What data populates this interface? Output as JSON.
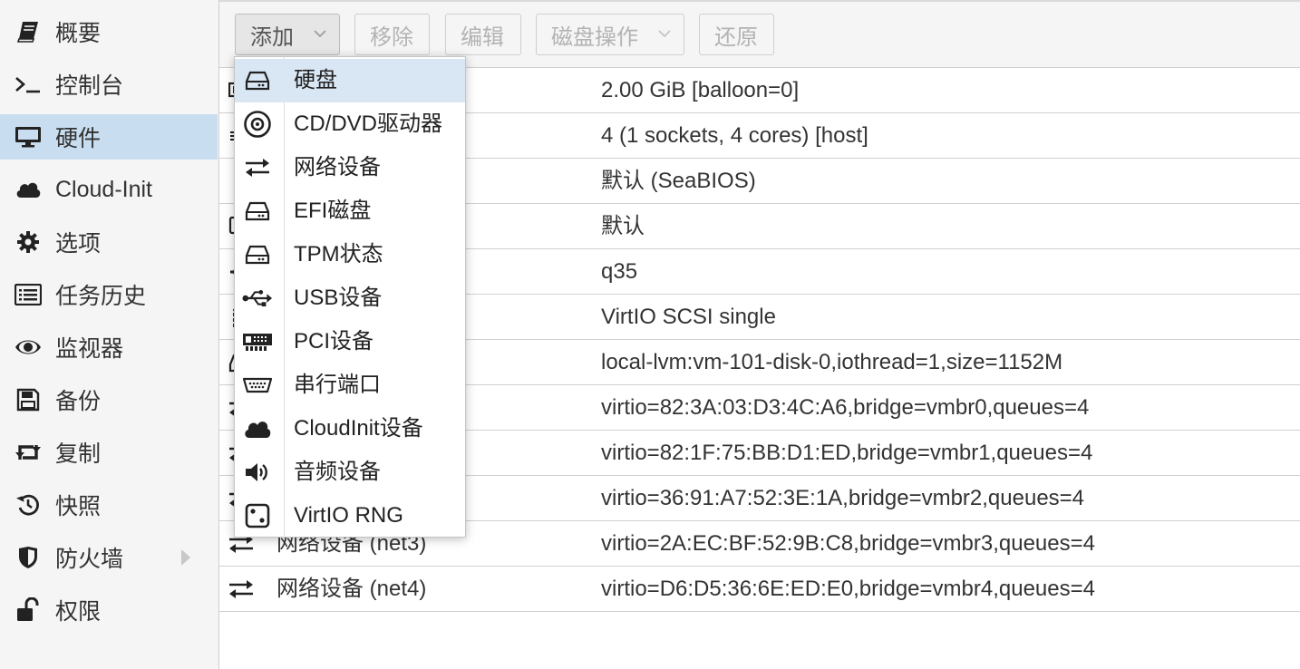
{
  "sidebar": {
    "items": [
      {
        "label": "概要",
        "icon": "book-icon",
        "active": false
      },
      {
        "label": "控制台",
        "icon": "terminal-icon",
        "active": false
      },
      {
        "label": "硬件",
        "icon": "monitor-icon",
        "active": true
      },
      {
        "label": "Cloud-Init",
        "icon": "cloud-icon",
        "active": false
      },
      {
        "label": "选项",
        "icon": "gear-icon",
        "active": false
      },
      {
        "label": "任务历史",
        "icon": "list-icon",
        "active": false
      },
      {
        "label": "监视器",
        "icon": "eye-icon",
        "active": false
      },
      {
        "label": "备份",
        "icon": "floppy-icon",
        "active": false
      },
      {
        "label": "复制",
        "icon": "retweet-icon",
        "active": false
      },
      {
        "label": "快照",
        "icon": "history-icon",
        "active": false
      },
      {
        "label": "防火墙",
        "icon": "shield-icon",
        "active": false
      },
      {
        "label": "权限",
        "icon": "unlock-icon",
        "active": false
      }
    ]
  },
  "toolbar": {
    "add_label": "添加",
    "remove_label": "移除",
    "edit_label": "编辑",
    "disk_action_label": "磁盘操作",
    "revert_label": "还原"
  },
  "table": {
    "rows": [
      {
        "name": "",
        "value": "2.00 GiB [balloon=0]",
        "icon": "memory-icon"
      },
      {
        "name": "",
        "value": "4 (1 sockets, 4 cores) [host]",
        "icon": "cpu-icon"
      },
      {
        "name": "",
        "value": "默认 (SeaBIOS)",
        "icon": "microchip-icon"
      },
      {
        "name": "",
        "value": "默认",
        "icon": "desktop-icon"
      },
      {
        "name": "",
        "value": "q35",
        "icon": "cogs-icon"
      },
      {
        "name": "",
        "value": "VirtIO SCSI single",
        "icon": "database-icon"
      },
      {
        "name": "",
        "value": "local-lvm:vm-101-disk-0,iothread=1,size=1152M",
        "icon": "hdd-icon"
      },
      {
        "name": "",
        "value": "virtio=82:3A:03:D3:4C:A6,bridge=vmbr0,queues=4",
        "icon": "exchange-icon"
      },
      {
        "name": "",
        "value": "virtio=82:1F:75:BB:D1:ED,bridge=vmbr1,queues=4",
        "icon": "exchange-icon"
      },
      {
        "name": "",
        "value": "virtio=36:91:A7:52:3E:1A,bridge=vmbr2,queues=4",
        "icon": "exchange-icon"
      },
      {
        "name": "网络设备 (net3)",
        "value": "virtio=2A:EC:BF:52:9B:C8,bridge=vmbr3,queues=4",
        "icon": "exchange-icon"
      },
      {
        "name": "网络设备 (net4)",
        "value": "virtio=D6:D5:36:6E:ED:E0,bridge=vmbr4,queues=4",
        "icon": "exchange-icon"
      }
    ]
  },
  "add_menu": {
    "items": [
      {
        "label": "硬盘",
        "icon": "hdd-icon",
        "active": true
      },
      {
        "label": "CD/DVD驱动器",
        "icon": "cdrom-icon",
        "active": false
      },
      {
        "label": "网络设备",
        "icon": "exchange-icon",
        "active": false
      },
      {
        "label": "EFI磁盘",
        "icon": "hdd-icon",
        "active": false
      },
      {
        "label": "TPM状态",
        "icon": "hdd-icon",
        "active": false
      },
      {
        "label": "USB设备",
        "icon": "usb-icon",
        "active": false
      },
      {
        "label": "PCI设备",
        "icon": "pci-card-icon",
        "active": false
      },
      {
        "label": "串行端口",
        "icon": "serial-port-icon",
        "active": false
      },
      {
        "label": "CloudInit设备",
        "icon": "cloud-icon",
        "active": false
      },
      {
        "label": "音频设备",
        "icon": "volume-icon",
        "active": false
      },
      {
        "label": "VirtIO RNG",
        "icon": "dice-icon",
        "active": false
      }
    ]
  },
  "colors": {
    "sidebar_active_bg": "#c9ddf0",
    "menu_active_bg": "#d9e7f5",
    "sidebar_bg": "#f5f5f5",
    "border": "#d0d0d0"
  }
}
